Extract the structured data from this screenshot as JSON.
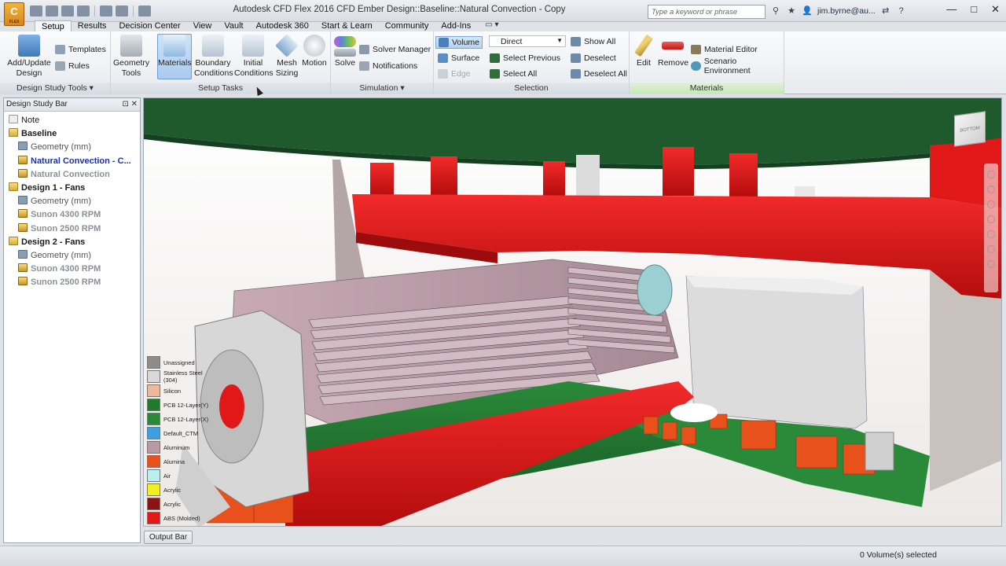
{
  "window": {
    "title": "Autodesk CFD Flex 2016   CFD Ember Design::Baseline::Natural Convection - Copy",
    "app_badge": "C",
    "app_badge_sub": "FLEX",
    "search_placeholder": "Type a keyword or phrase",
    "user": "jim.byrne@au...",
    "help": "?",
    "minimize": "—",
    "maximize": "□",
    "close": "✕"
  },
  "tabs": [
    {
      "label": "Setup",
      "active": true
    },
    {
      "label": "Results"
    },
    {
      "label": "Decision Center"
    },
    {
      "label": "View"
    },
    {
      "label": "Vault"
    },
    {
      "label": "Autodesk 360"
    },
    {
      "label": "Start & Learn"
    },
    {
      "label": "Community"
    },
    {
      "label": "Add-Ins"
    }
  ],
  "ribbon": {
    "design_study_tools": {
      "label": "Design Study Tools ▾",
      "add_update": "Add/Update",
      "add_update2": "Design",
      "templates": "Templates",
      "rules": "Rules"
    },
    "setup_tasks": {
      "label": "Setup Tasks",
      "geometry_tools": "Geometry",
      "geometry_tools2": "Tools",
      "materials": "Materials",
      "boundary": "Boundary",
      "boundary2": "Conditions",
      "initial": "Initial",
      "initial2": "Conditions",
      "mesh": "Mesh",
      "mesh2": "Sizing",
      "motion": "Motion"
    },
    "simulation": {
      "label": "Simulation ▾",
      "solve": "Solve",
      "solver_manager": "Solver Manager",
      "notifications": "Notifications"
    },
    "selection": {
      "label": "Selection",
      "volume": "Volume",
      "surface": "Surface",
      "edge": "Edge",
      "mode": "Direct",
      "select_previous": "Select Previous",
      "select_all": "Select All",
      "show_all": "Show All",
      "deselect": "Deselect",
      "deselect_all": "Deselect All"
    },
    "materials": {
      "label": "Materials",
      "edit": "Edit",
      "remove": "Remove",
      "material_editor": "Material Editor",
      "scenario_environment": "Scenario Environment"
    }
  },
  "design_study_bar": {
    "title": "Design Study Bar",
    "pin": "⊡",
    "close": "✕",
    "tree": [
      {
        "label": "Note",
        "indent": 0,
        "icon": "note",
        "style": "normal"
      },
      {
        "label": "Baseline",
        "indent": 0,
        "icon": "folder",
        "style": "bold"
      },
      {
        "label": "Geometry (mm)",
        "indent": 1,
        "icon": "geom",
        "style": "gray2"
      },
      {
        "label": "Natural Convection - C...",
        "indent": 1,
        "icon": "scen",
        "style": "blue"
      },
      {
        "label": "Natural Convection",
        "indent": 1,
        "icon": "scen",
        "style": "gray"
      },
      {
        "label": "Design 1 - Fans",
        "indent": 0,
        "icon": "folder",
        "style": "bold"
      },
      {
        "label": "Geometry (mm)",
        "indent": 1,
        "icon": "geom",
        "style": "gray2"
      },
      {
        "label": "Sunon 4300 RPM",
        "indent": 1,
        "icon": "scen",
        "style": "gray"
      },
      {
        "label": "Sunon 2500 RPM",
        "indent": 1,
        "icon": "scen",
        "style": "gray"
      },
      {
        "label": "Design 2 - Fans",
        "indent": 0,
        "icon": "folder",
        "style": "bold"
      },
      {
        "label": "Geometry (mm)",
        "indent": 1,
        "icon": "geom",
        "style": "gray2"
      },
      {
        "label": "Sunon 4300 RPM",
        "indent": 1,
        "icon": "scen",
        "style": "gray"
      },
      {
        "label": "Sunon 2500 RPM",
        "indent": 1,
        "icon": "scen",
        "style": "gray"
      }
    ]
  },
  "legend": [
    {
      "label": "Unassigned",
      "color": "#8c8c8c"
    },
    {
      "label": "Stainless Steel (304)",
      "color": "#d9d9d9"
    },
    {
      "label": "Silicon",
      "color": "#e9b99a"
    },
    {
      "label": "PCB 12-Layer(Y)",
      "color": "#1f7a2e"
    },
    {
      "label": "PCB 12-Layer(X)",
      "color": "#2a8a3a"
    },
    {
      "label": "Default_CTM",
      "color": "#3aa0e0"
    },
    {
      "label": "Aluminum",
      "color": "#b99aa4"
    },
    {
      "label": "Alumina",
      "color": "#e8501c"
    },
    {
      "label": "Air",
      "color": "#b8f0f0"
    },
    {
      "label": "Acrylic",
      "color": "#f2f020"
    },
    {
      "label": "Acrylic",
      "color": "#8a1414"
    },
    {
      "label": "ABS (Molded)",
      "color": "#e01818"
    }
  ],
  "viewcube_label": "BOTTOM",
  "output_bar": "Output Bar",
  "status": "0 Volume(s) selected"
}
